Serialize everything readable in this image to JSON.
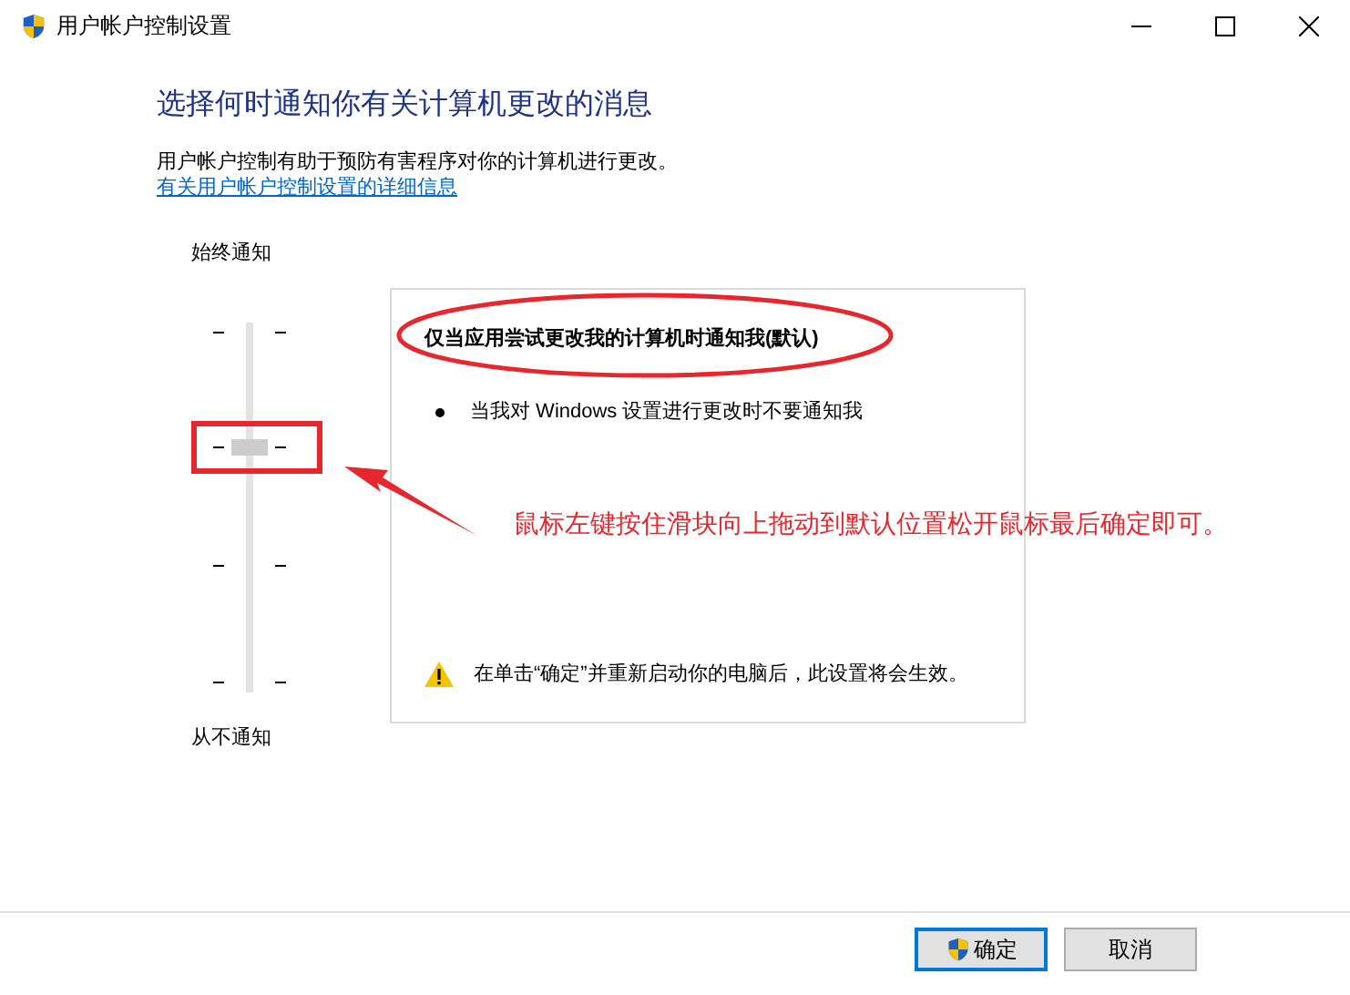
{
  "window": {
    "title": "用户帐户控制设置"
  },
  "heading": "选择何时通知你有关计算机更改的消息",
  "description": "用户帐户控制有助于预防有害程序对你的计算机进行更改。",
  "link": "有关用户帐户控制设置的详细信息",
  "slider": {
    "top_label": "始终通知",
    "bottom_label": "从不通知",
    "level": 0.67
  },
  "panel": {
    "title": "仅当应用尝试更改我的计算机时通知我(默认)",
    "bullets": [
      "当我对 Windows 设置进行更改时不要通知我"
    ],
    "note": "在单击“确定”并重新启动你的电脑后，此设置将会生效。"
  },
  "annotation": {
    "text": "鼠标左键按住滑块向上拖动到默认位置松开鼠标最后确定即可。"
  },
  "buttons": [
    {
      "label": "确定",
      "kind": "primary"
    },
    {
      "label": "取消",
      "kind": "normal"
    }
  ]
}
